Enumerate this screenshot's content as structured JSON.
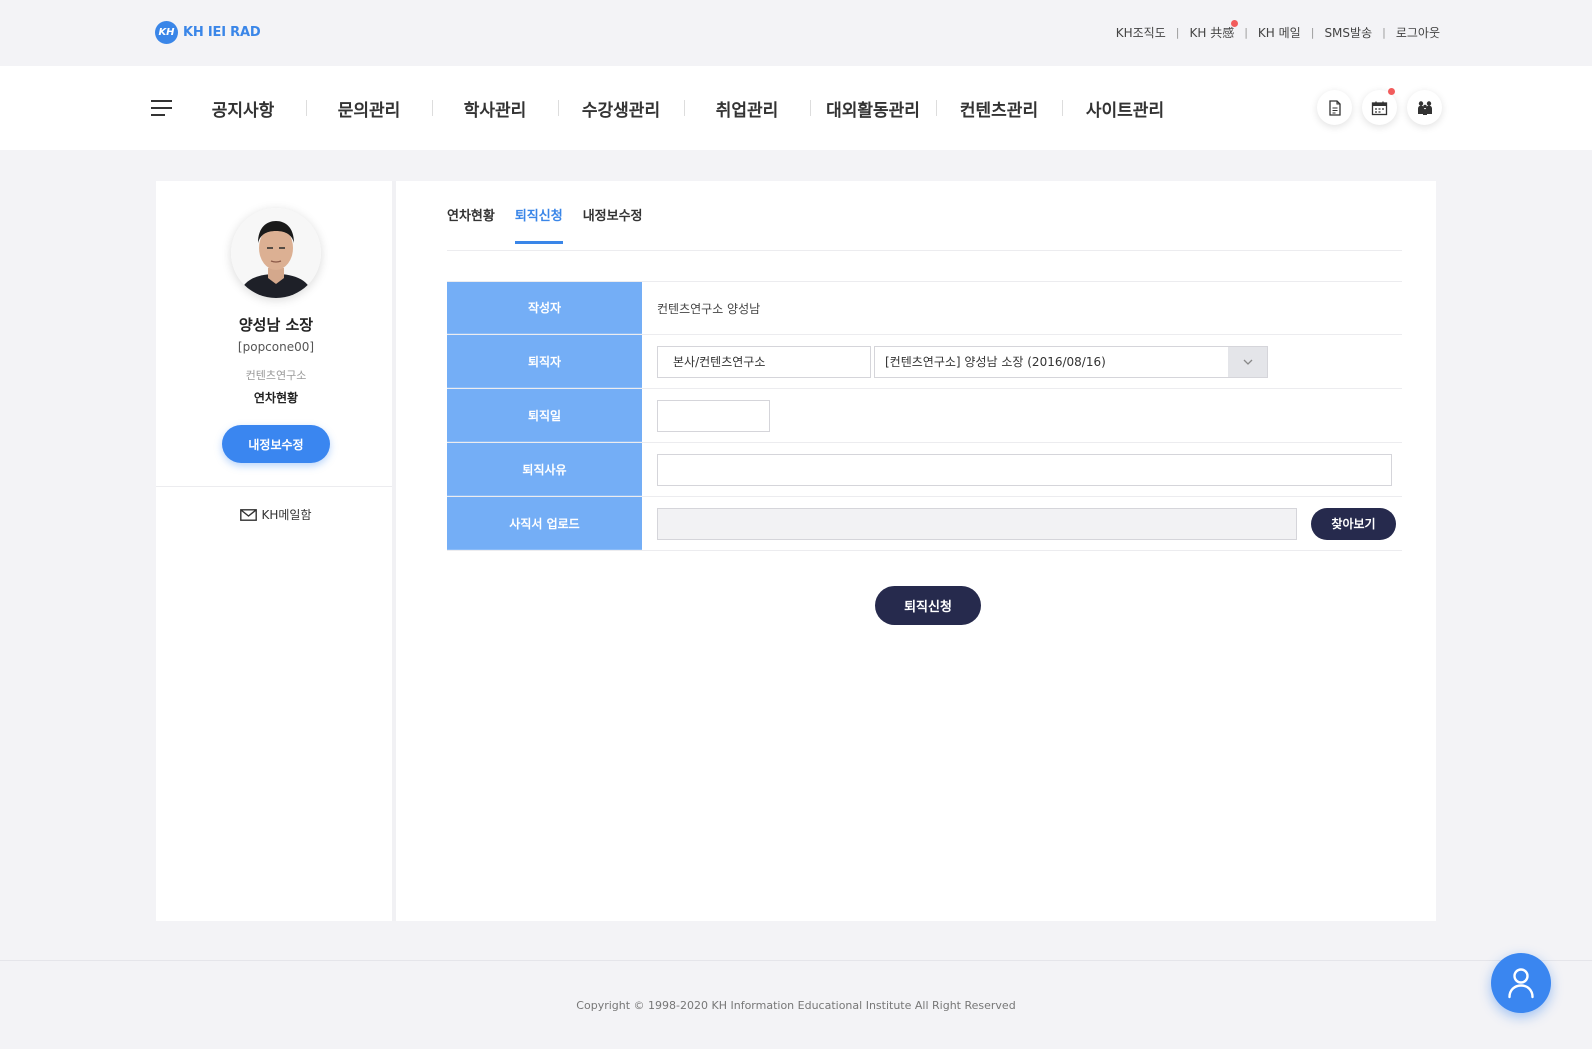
{
  "header": {
    "logo_mark": "KH",
    "logo_text": "KH IEI RAD",
    "util_links": [
      "KH조직도",
      "KH 共感",
      "KH 메일",
      "SMS발송",
      "로그아웃"
    ]
  },
  "gnb": {
    "menu": [
      "공지사항",
      "문의관리",
      "학사관리",
      "수강생관리",
      "취업관리",
      "대외활동관리",
      "컨텐츠관리",
      "사이트관리"
    ],
    "icons": [
      "document-icon",
      "calendar-icon",
      "people-icon"
    ]
  },
  "sidebar": {
    "name": "양성남 소장",
    "user_id": "[popcone00]",
    "dept": "컨텐츠연구소",
    "status": "연차현황",
    "button": "내정보수정",
    "mailbox": "KH메일함"
  },
  "tabs": [
    {
      "label": "연차현황",
      "active": false
    },
    {
      "label": "퇴직신청",
      "active": true
    },
    {
      "label": "내정보수정",
      "active": false
    }
  ],
  "form": {
    "writer_label": "작성자",
    "writer_value": "컨텐츠연구소 양성남",
    "retiree_label": "퇴직자",
    "retiree_dept": "본사/컨텐츠연구소",
    "retiree_select": "[컨텐츠연구소] 양성남 소장 (2016/08/16)",
    "date_label": "퇴직일",
    "reason_label": "퇴직사유",
    "upload_label": "사직서 업로드",
    "browse_button": "찾아보기"
  },
  "submit_button": "퇴직신청",
  "footer": {
    "copyright": "Copyright © 1998-2020 KH Information Educational Institute All Right Reserved"
  },
  "colors": {
    "accent": "#3a86e8",
    "label_bg": "#74aef6",
    "dark_button": "#262a4d",
    "notification": "#f25c5c"
  }
}
